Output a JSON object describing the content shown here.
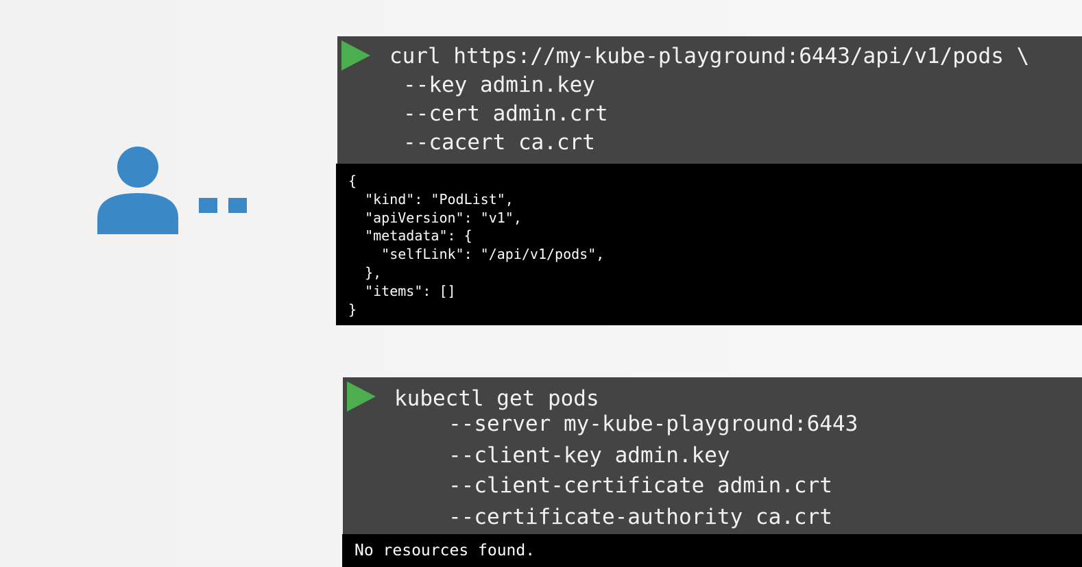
{
  "colors": {
    "user_icon": "#3b88c6",
    "play_icon": "#4cae4f",
    "command_bg": "#444444",
    "output_bg": "#000000"
  },
  "curl_block": {
    "command_lines": [
      "curl https://my-kube-playground:6443/api/v1/pods \\",
      "--key admin.key",
      "--cert admin.crt",
      "--cacert ca.crt"
    ],
    "output_lines": [
      "{",
      "  \"kind\": \"PodList\",",
      "  \"apiVersion\": \"v1\",",
      "  \"metadata\": {",
      "    \"selfLink\": \"/api/v1/pods\",",
      "  },",
      "  \"items\": []",
      "}"
    ]
  },
  "kubectl_block": {
    "command_lines": [
      "kubectl get pods",
      "--server my-kube-playground:6443",
      "--client-key admin.key",
      "--client-certificate admin.crt",
      "--certificate-authority ca.crt"
    ],
    "output_lines": [
      "No resources found."
    ]
  }
}
